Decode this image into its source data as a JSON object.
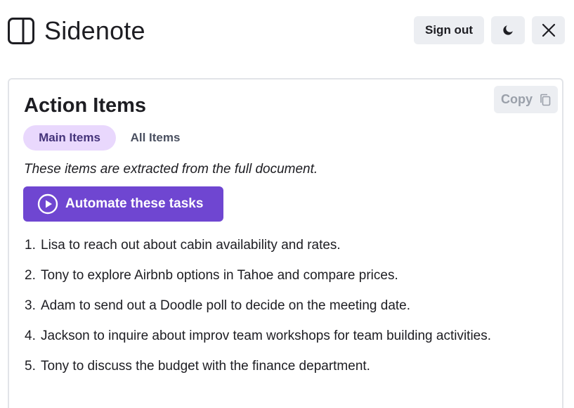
{
  "app": {
    "title": "Sidenote"
  },
  "header": {
    "signout_label": "Sign out",
    "theme_icon": "moon-icon",
    "close_icon": "close-icon"
  },
  "card": {
    "title": "Action Items",
    "copy_label": "Copy",
    "tabs": [
      {
        "label": "Main Items",
        "active": true
      },
      {
        "label": "All Items",
        "active": false
      }
    ],
    "subtitle": "These items are extracted from the full document.",
    "automate_label": "Automate these tasks",
    "items": [
      {
        "num": "1.",
        "text": "Lisa to reach out about cabin availability and rates."
      },
      {
        "num": "2.",
        "text": "Tony to explore Airbnb options in Tahoe and compare prices."
      },
      {
        "num": "3.",
        "text": "Adam to send out a Doodle poll to decide on the meeting date."
      },
      {
        "num": "4.",
        "text": "Jackson to inquire about improv team workshops for team building activities."
      },
      {
        "num": "5.",
        "text": "Tony to discuss the budget with the finance department."
      }
    ]
  },
  "colors": {
    "accent": "#6f46d1",
    "tab_active_bg": "#e9d8fd",
    "tab_active_text": "#44337a",
    "button_gray": "#eceef2"
  }
}
